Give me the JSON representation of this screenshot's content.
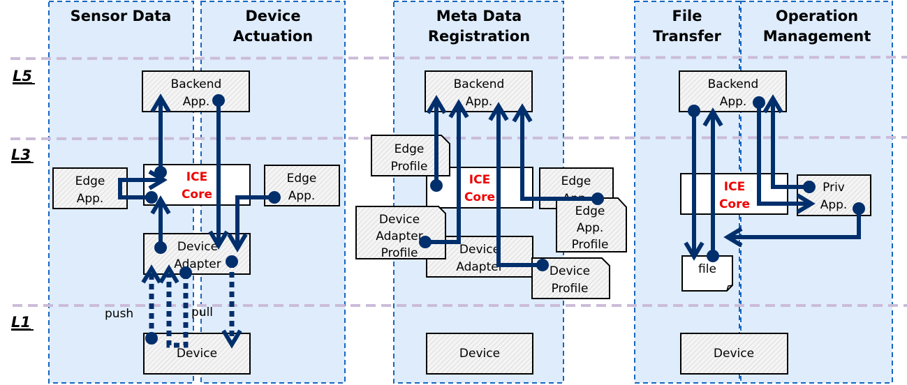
{
  "colors": {
    "column_fill": "#deecfc",
    "column_border": "#1565c0",
    "layer_line": "#cbbcd8",
    "flow": "#002f6c",
    "ice_core_text": "#ee0000"
  },
  "layers": [
    {
      "id": "L5",
      "label": "L5"
    },
    {
      "id": "L3",
      "label": "L3"
    },
    {
      "id": "L1",
      "label": "L1"
    }
  ],
  "columns": [
    {
      "id": "sensor-data",
      "title_lines": [
        "Sensor Data"
      ]
    },
    {
      "id": "device-actuation",
      "title_lines": [
        "Device",
        "Actuation"
      ]
    },
    {
      "id": "meta-data-registration",
      "title_lines": [
        "Meta Data",
        "Registration"
      ]
    },
    {
      "id": "file-transfer",
      "title_lines": [
        "File",
        "Transfer"
      ]
    },
    {
      "id": "operation-management",
      "title_lines": [
        "Operation",
        "Management"
      ]
    }
  ],
  "components": {
    "backend_app": [
      "Backend",
      "App."
    ],
    "ice_core": [
      "ICE",
      "Core"
    ],
    "edge_app": [
      "Edge",
      "App."
    ],
    "device_adapter": [
      "Device",
      "Adapter"
    ],
    "device": [
      "Device"
    ],
    "edge_profile": [
      "Edge",
      "Profile"
    ],
    "device_adapter_profile": [
      "Device",
      "Adapter",
      "Profile"
    ],
    "edge_app_profile": [
      "Edge",
      "App.",
      "Profile"
    ],
    "device_profile": [
      "Device",
      "Profile"
    ],
    "file": [
      "file"
    ],
    "priv_app": [
      "Priv",
      "App."
    ]
  },
  "annotations": {
    "push": "push",
    "pull": "pull"
  }
}
